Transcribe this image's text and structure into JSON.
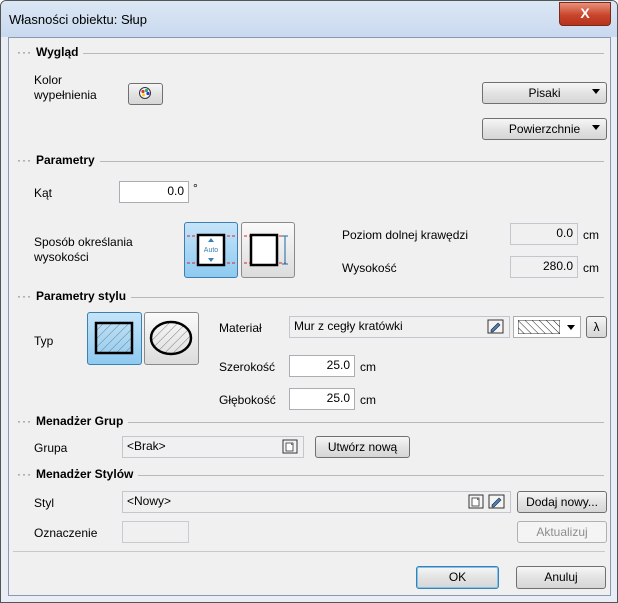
{
  "window": {
    "title": "Własności obiektu: Słup",
    "close": "X"
  },
  "wyglad": {
    "section": "Wygląd",
    "fill_color_label_1": "Kolor",
    "fill_color_label_2": "wypełnienia",
    "pisaki": "Pisaki",
    "powierzchnie": "Powierzchnie"
  },
  "parametry": {
    "section": "Parametry",
    "angle_label": "Kąt",
    "angle_value": "0.0",
    "angle_unit": "°",
    "height_method_label_1": "Sposób określania",
    "height_method_label_2": "wysokości",
    "auto_label": "Auto",
    "bottom_edge_label": "Poziom dolnej krawędzi",
    "bottom_edge_value": "0.0",
    "bottom_edge_unit": "cm",
    "height_label": "Wysokość",
    "height_value": "280.0",
    "height_unit": "cm"
  },
  "styl": {
    "section": "Parametry stylu",
    "type_label": "Typ",
    "material_label": "Materiał",
    "material_value": "Mur z cegły kratówki",
    "lambda": "λ",
    "width_label": "Szerokość",
    "width_value": "25.0",
    "width_unit": "cm",
    "depth_label": "Głębokość",
    "depth_value": "25.0",
    "depth_unit": "cm"
  },
  "grupy": {
    "section": "Menadżer Grup",
    "group_label": "Grupa",
    "group_value": "<Brak>",
    "create_new": "Utwórz nową"
  },
  "style_mgr": {
    "section": "Menadżer Stylów",
    "style_label": "Styl",
    "style_value": "<Nowy>",
    "add_new": "Dodaj nowy...",
    "marking_label": "Oznaczenie",
    "marking_value": "",
    "update": "Aktualizuj"
  },
  "footer": {
    "ok": "OK",
    "cancel": "Anuluj"
  },
  "colors": {
    "accent_blue": "#8fcaf0",
    "title_bg": "#c9d9ee",
    "close_red": "#c8452c"
  }
}
